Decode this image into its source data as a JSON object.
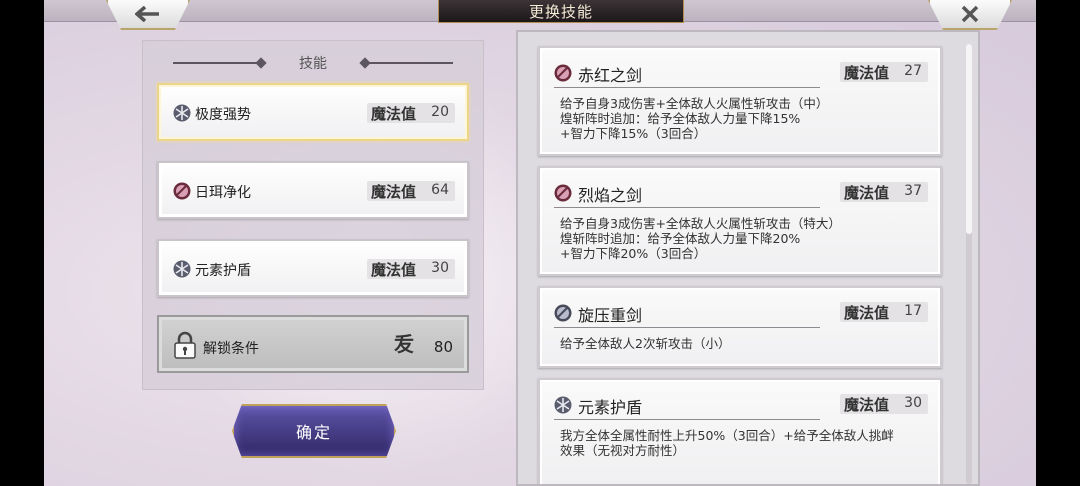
{
  "header": {
    "title": "更换技能",
    "back_icon": "arrow-left-icon",
    "close_icon": "close-icon"
  },
  "equipped": {
    "section_title": "技能",
    "slots": [
      {
        "name": "极度强势",
        "mp_label": "魔法值",
        "mp": "20",
        "icon": "snowflake-icon",
        "selected": true
      },
      {
        "name": "日珥净化",
        "mp_label": "魔法值",
        "mp": "64",
        "icon": "red-orb-icon",
        "selected": false
      },
      {
        "name": "元素护盾",
        "mp_label": "魔法值",
        "mp": "30",
        "icon": "snowflake-icon",
        "selected": false
      }
    ],
    "locked": {
      "label": "解锁条件",
      "value": "80",
      "icon": "lock-icon",
      "mark_icon": "unlock-rank-mark-icon",
      "mark_glyph": "叐"
    }
  },
  "confirm_label": "确定",
  "available": {
    "skills": [
      {
        "name": "赤红之剑",
        "mp_label": "魔法值",
        "mp": "27",
        "icon": "red-orb-icon",
        "desc": "给予自身3成伤害+全体敌人火属性斩攻击（中）\n煌斩阵时追加：给予全体敌人力量下降15%\n+智力下降15%（3回合）"
      },
      {
        "name": "烈焰之剑",
        "mp_label": "魔法值",
        "mp": "37",
        "icon": "red-orb-icon",
        "desc": "给予自身3成伤害+全体敌人火属性斩攻击（特大）\n煌斩阵时追加：给予全体敌人力量下降20%\n+智力下降20%（3回合）"
      },
      {
        "name": "旋压重剑",
        "mp_label": "魔法值",
        "mp": "17",
        "icon": "grey-orb-icon",
        "desc": "给予全体敌人2次斩攻击（小）"
      },
      {
        "name": "元素护盾",
        "mp_label": "魔法值",
        "mp": "30",
        "icon": "snowflake-icon",
        "desc": "我方全体全属性耐性上升50%（3回合）+给予全体敌人挑衅\n效果（无视对方耐性）"
      }
    ]
  },
  "colors": {
    "selected_border": "#ecd58a",
    "confirm_bg": "#4a3f8c",
    "gold_trim": "#c0a15a"
  }
}
